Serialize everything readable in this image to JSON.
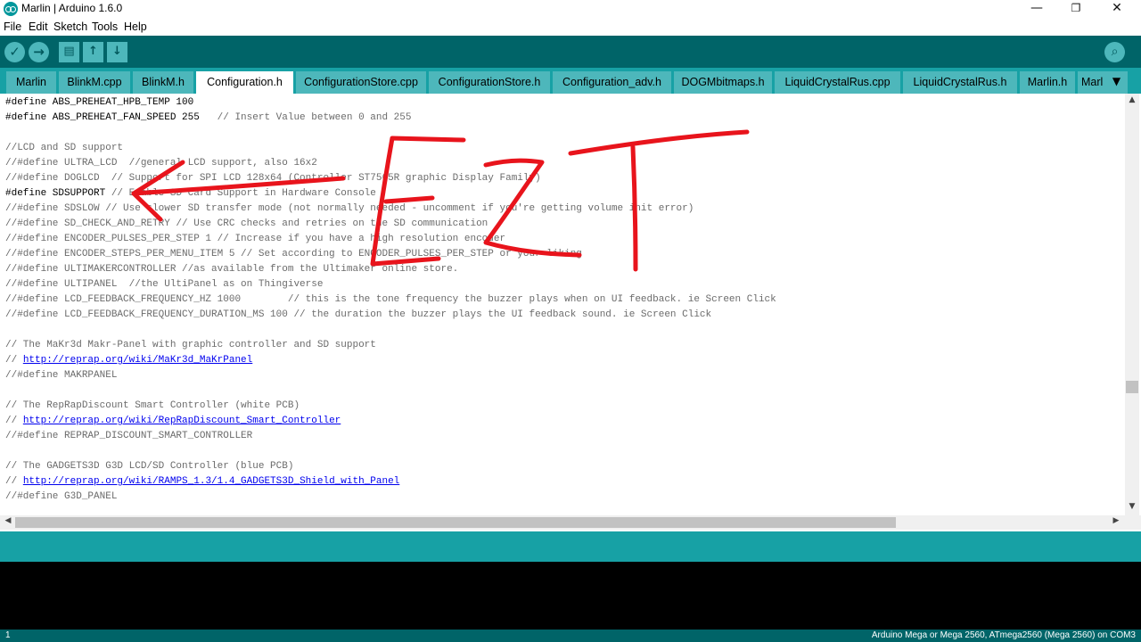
{
  "window": {
    "title": "Marlin | Arduino 1.6.0",
    "minimize_glyph": "—",
    "maximize_glyph": "❐",
    "close_glyph": "✕"
  },
  "menu": [
    "File",
    "Edit",
    "Sketch",
    "Tools",
    "Help"
  ],
  "toolbar": {
    "verify_glyph": "✓",
    "upload_glyph": "→",
    "new_glyph": "▤",
    "open_glyph": "↑",
    "save_glyph": "↓",
    "serial_glyph": "⌕"
  },
  "tabs": [
    "Marlin",
    "BlinkM.cpp",
    "BlinkM.h",
    "Configuration.h",
    "ConfigurationStore.cpp",
    "ConfigurationStore.h",
    "Configuration_adv.h",
    "DOGMbitmaps.h",
    "LiquidCrystalRus.cpp",
    "LiquidCrystalRus.h",
    "Marlin.h",
    "Marl"
  ],
  "active_tab": "Configuration.h",
  "tab_menu_glyph": "▼",
  "code": {
    "l0": {
      "a": "#define ABS_PREHEAT_HPB_TEMP 100"
    },
    "l1": {
      "a": "#define ABS_PREHEAT_FAN_SPEED 255   ",
      "b": "// Insert Value between 0 and 255"
    },
    "l3": {
      "b": "//LCD and SD support"
    },
    "l4": {
      "b": "//#define ULTRA_LCD  //general LCD support, also 16x2"
    },
    "l5": {
      "b": "//#define DOGLCD  // Support for SPI LCD 128x64 (Controller ST7565R graphic Display Family)"
    },
    "l6": {
      "a": "#define SDSUPPORT ",
      "b": "// Enable SD Card Support in Hardware Console"
    },
    "l7": {
      "b": "//#define SDSLOW // Use slower SD transfer mode (not normally needed - uncomment if you're getting volume init error)"
    },
    "l8": {
      "b": "//#define SD_CHECK_AND_RETRY // Use CRC checks and retries on the SD communication"
    },
    "l9": {
      "b": "//#define ENCODER_PULSES_PER_STEP 1 // Increase if you have a high resolution encoder"
    },
    "l10": {
      "b": "//#define ENCODER_STEPS_PER_MENU_ITEM 5 // Set according to ENCODER_PULSES_PER_STEP or your liking"
    },
    "l11": {
      "b": "//#define ULTIMAKERCONTROLLER //as available from the Ultimaker online store."
    },
    "l12": {
      "b": "//#define ULTIPANEL  //the UltiPanel as on Thingiverse"
    },
    "l13": {
      "b": "//#define LCD_FEEDBACK_FREQUENCY_HZ 1000        // this is the tone frequency the buzzer plays when on UI feedback. ie Screen Click"
    },
    "l14": {
      "b": "//#define LCD_FEEDBACK_FREQUENCY_DURATION_MS 100 // the duration the buzzer plays the UI feedback sound. ie Screen Click"
    },
    "l16": {
      "b": "// The MaKr3d Makr-Panel with graphic controller and SD support"
    },
    "l17": {
      "b": "// ",
      "c": "http://reprap.org/wiki/MaKr3d_MaKrPanel"
    },
    "l18": {
      "b": "//#define MAKRPANEL"
    },
    "l20": {
      "b": "// The RepRapDiscount Smart Controller (white PCB)"
    },
    "l21": {
      "b": "// ",
      "c": "http://reprap.org/wiki/RepRapDiscount_Smart_Controller"
    },
    "l22": {
      "b": "//#define REPRAP_DISCOUNT_SMART_CONTROLLER"
    },
    "l24": {
      "b": "// The GADGETS3D G3D LCD/SD Controller (blue PCB)"
    },
    "l25": {
      "b": "// ",
      "c": "http://reprap.org/wiki/RAMPS_1.3/1.4_GADGETS3D_Shield_with_Panel"
    },
    "l26": {
      "b": "//#define G3D_PANEL"
    }
  },
  "scroll_glyphs": {
    "up": "▲",
    "down": "▼",
    "left": "◀",
    "right": "▶"
  },
  "status": {
    "line": "1",
    "board": "Arduino Mega or Mega 2560, ATmega2560 (Mega 2560) on COM3"
  },
  "colors": {
    "toolbar": "#006468",
    "tabbar": "#17a1a5",
    "tab": "#4db7bb",
    "annotation": "#e8141c"
  }
}
